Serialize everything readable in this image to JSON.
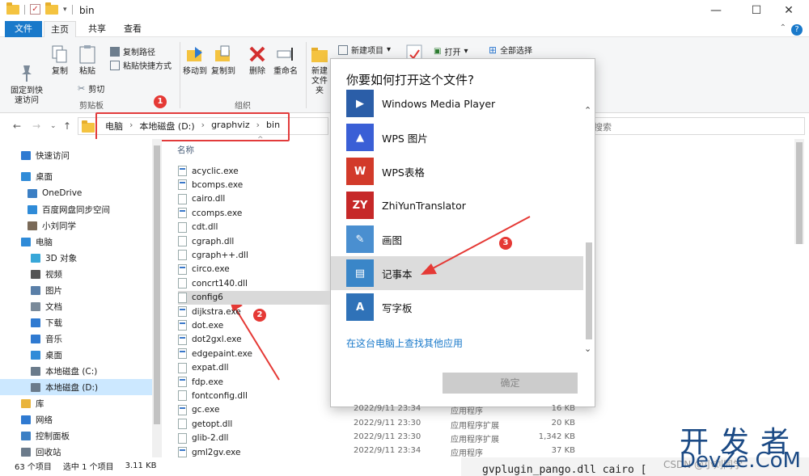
{
  "window": {
    "title": "bin",
    "minimize": "—",
    "maximize": "☐",
    "close": "✕"
  },
  "ribbon_tabs": [
    "文件",
    "主页",
    "共享",
    "查看"
  ],
  "ribbon": {
    "pin_label": "固定到快\n速访问",
    "copy_label": "复制",
    "paste_label": "粘贴",
    "copy_path_label": "复制路径",
    "paste_shortcut_label": "粘贴快捷方式",
    "cut_label": "剪切",
    "clipboard_group": "剪贴板",
    "move_to_label": "移动到",
    "copy_to_label": "复制到",
    "delete_label": "删除",
    "rename_label": "重命名",
    "organize_group": "组织",
    "new_label": "新建",
    "new_folder_label": "文件夹",
    "new_item_label": "新建项目",
    "open_label": "打开",
    "select_all_label": "全部选择"
  },
  "address": {
    "crumbs": [
      "电脑",
      "本地磁盘 (D:)",
      "graphviz",
      "bin"
    ],
    "search_placeholder": "搜索"
  },
  "nav": [
    {
      "label": "快速访问",
      "color": "#2f7ad1"
    },
    {
      "label": "桌面",
      "color": "#2f8bd8"
    },
    {
      "label": "OneDrive",
      "color": "#3b7fc4"
    },
    {
      "label": "百度网盘同步空间",
      "color": "#2f8bd8"
    },
    {
      "label": "小刘同学",
      "color": "#7a6a58"
    },
    {
      "label": "电脑",
      "color": "#2f8bd8"
    },
    {
      "label": "3D 对象",
      "color": "#38a7d8"
    },
    {
      "label": "视频",
      "color": "#555555"
    },
    {
      "label": "图片",
      "color": "#5a7fa8"
    },
    {
      "label": "文档",
      "color": "#7a8a9a"
    },
    {
      "label": "下载",
      "color": "#2f7ad1"
    },
    {
      "label": "音乐",
      "color": "#2f7ad1"
    },
    {
      "label": "桌面",
      "color": "#2f8bd8"
    },
    {
      "label": "本地磁盘 (C:)",
      "color": "#6b7b8b"
    },
    {
      "label": "本地磁盘 (D:)",
      "color": "#6b7b8b"
    },
    {
      "label": "库",
      "color": "#e9b43b"
    },
    {
      "label": "网络",
      "color": "#2f7ad1"
    },
    {
      "label": "控制面板",
      "color": "#3b7fc4"
    },
    {
      "label": "回收站",
      "color": "#6b7b8b"
    }
  ],
  "files": {
    "column_name": "名称",
    "items": [
      "acyclic.exe",
      "bcomps.exe",
      "cairo.dll",
      "ccomps.exe",
      "cdt.dll",
      "cgraph.dll",
      "cgraph++.dll",
      "circo.exe",
      "concrt140.dll",
      "config6",
      "dijkstra.exe",
      "dot.exe",
      "dot2gxl.exe",
      "edgepaint.exe",
      "expat.dll",
      "fdp.exe",
      "fontconfig.dll",
      "gc.exe",
      "getopt.dll",
      "glib-2.dll",
      "gml2gv.exe"
    ],
    "details": [
      {
        "date": "2022/9/11 23:34",
        "type": "应用程序",
        "size": "16 KB"
      },
      {
        "date": "2022/9/11 23:30",
        "type": "应用程序扩展",
        "size": "20 KB"
      },
      {
        "date": "2022/9/11 23:30",
        "type": "应用程序扩展",
        "size": "1,342 KB"
      },
      {
        "date": "2022/9/11 23:34",
        "type": "应用程序",
        "size": "37 KB"
      }
    ]
  },
  "status": {
    "count": "63 个项目",
    "selection": "选中 1 个项目",
    "size": "3.11 KB"
  },
  "dialog": {
    "title": "你要如何打开这个文件?",
    "apps": [
      {
        "name": "Windows Media Player",
        "icon": "media-player-icon",
        "color": "#2b5ea8",
        "glyph": "▶"
      },
      {
        "name": "WPS 图片",
        "icon": "wps-picture-icon",
        "color": "#3a5fd6",
        "glyph": "▲"
      },
      {
        "name": "WPS表格",
        "icon": "wps-sheet-icon",
        "color": "#d23a2a",
        "glyph": "W"
      },
      {
        "name": "ZhiYunTranslator",
        "icon": "zhiyun-icon",
        "color": "#c62828",
        "glyph": "ZY"
      },
      {
        "name": "画图",
        "icon": "paint-icon",
        "color": "#4a8fd0",
        "glyph": "✎"
      },
      {
        "name": "记事本",
        "icon": "notepad-icon",
        "color": "#3a86c8",
        "glyph": "▤"
      },
      {
        "name": "写字板",
        "icon": "wordpad-icon",
        "color": "#2f72b8",
        "glyph": "A"
      }
    ],
    "more_link": "在这台电脑上查找其他应用",
    "ok": "确定"
  },
  "badges": [
    "1",
    "2",
    "3"
  ],
  "watermark": {
    "big": "开发者",
    "small": "DevZe.CoM",
    "csdn": "CSDN @小刘同学"
  },
  "behind_text": "gvplugin_pango.dll cairo [",
  "colors": {
    "accent": "#1979ca",
    "highlight": "#e23b3b",
    "selected": "#cce8ff"
  }
}
